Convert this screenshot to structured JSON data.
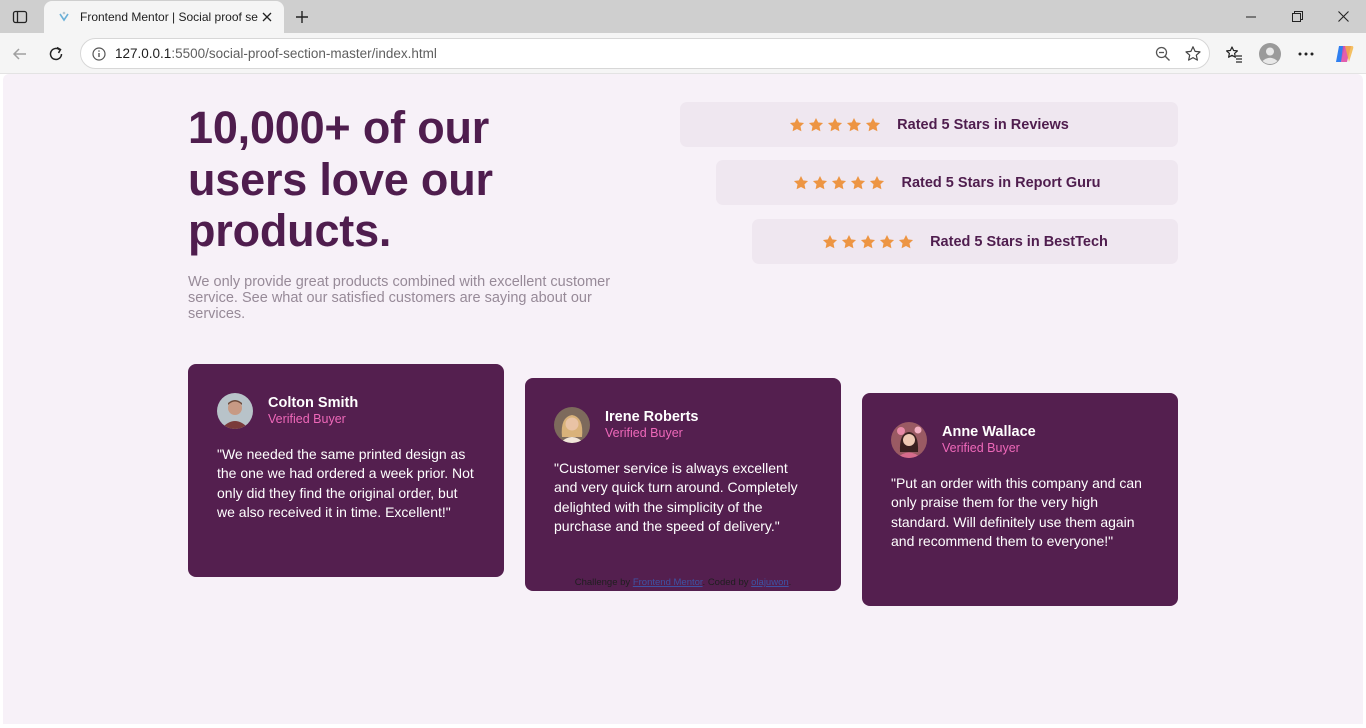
{
  "browser": {
    "tab_title": "Frontend Mentor | Social proof se",
    "url_host": "127.0.0.1",
    "url_path": ":5500/social-proof-section-master/index.html"
  },
  "page": {
    "heading": "10,000+ of our users love our products.",
    "subtext": "We only provide great products combined with excellent customer service. See what our satisfied customers are saying about our services.",
    "ratings": [
      {
        "label": "Rated 5 Stars in Reviews",
        "stars": 5
      },
      {
        "label": "Rated 5 Stars in Report Guru",
        "stars": 5
      },
      {
        "label": "Rated 5 Stars in BestTech",
        "stars": 5
      }
    ],
    "testimonials": [
      {
        "name": "Colton Smith",
        "role": "Verified Buyer",
        "quote": "\"We needed the same printed design as the one we had ordered a week prior. Not only did they find the original order, but we also received it in time. Excellent!\""
      },
      {
        "name": "Irene Roberts",
        "role": "Verified Buyer",
        "quote": "\"Customer service is always excellent and very quick turn around. Completely delighted with the simplicity of the purchase and the speed of delivery.\""
      },
      {
        "name": "Anne Wallace",
        "role": "Verified Buyer",
        "quote": "\"Put an order with this company and can only praise them for the very high standard. Will definitely use them again and recommend them to everyone!\""
      }
    ],
    "attribution": {
      "prefix": "Challenge by ",
      "link1": "Frontend Mentor",
      "middle": ". Coded by ",
      "link2": "olajuwon",
      "suffix": "."
    }
  },
  "colors": {
    "accent": "#4f1d4e",
    "card_bg": "#541f4f",
    "star": "#ed9543",
    "role": "#ee68b9",
    "page_bg": "#f7f1f8"
  }
}
